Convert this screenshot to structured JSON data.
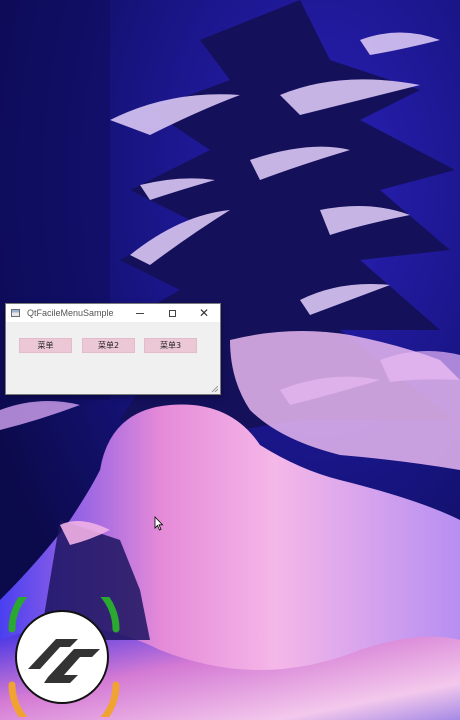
{
  "desktop": {
    "wallpaper": "snowy pine tree at night, blue and pink lighting"
  },
  "window": {
    "title": "QtFacileMenuSample",
    "icon": "app-window-icon",
    "controls": {
      "minimize_icon": "minimize-icon",
      "maximize_icon": "maximize-icon",
      "close_label": "✕"
    },
    "buttons": [
      {
        "label": "菜单"
      },
      {
        "label": "菜单2"
      },
      {
        "label": "菜单3"
      }
    ],
    "button_color": "#ecc8d6"
  },
  "overlay_logo": {
    "icon": "recorder-logo-icon",
    "ring_colors": [
      "#2aa82f",
      "#f0a232"
    ]
  },
  "colors": {
    "window_bg": "#f0f0f0",
    "titlebar_bg": "#ffffff"
  }
}
